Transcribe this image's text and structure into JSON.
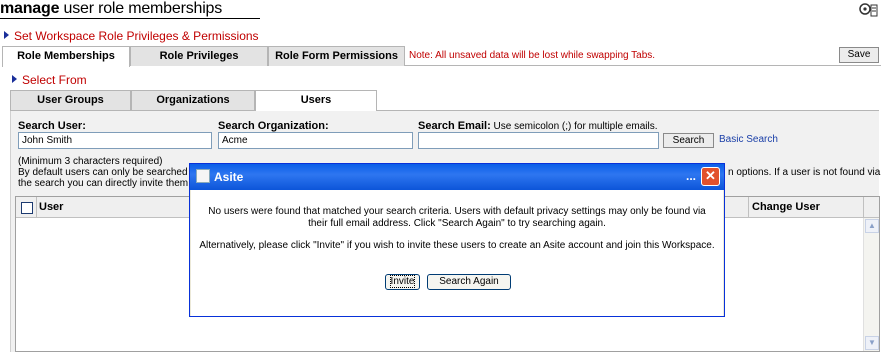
{
  "page": {
    "title_bold": "manage",
    "title_rest": " user role memberships"
  },
  "icons": {
    "corner": "role-settings-icon"
  },
  "section1": {
    "heading": "Set Workspace Role Privileges & Permissions"
  },
  "top_tabs": [
    {
      "label": "Role Memberships"
    },
    {
      "label": "Role Privileges"
    },
    {
      "label": "Role Form Permissions"
    }
  ],
  "tab_note": "Note: All unsaved data will be lost while swapping Tabs.",
  "save_label": "Save",
  "section2": {
    "heading": "Select From"
  },
  "sub_tabs": [
    {
      "label": "User Groups"
    },
    {
      "label": "Organizations"
    },
    {
      "label": "Users"
    }
  ],
  "search": {
    "user_label": "Search User:",
    "user_value": "John Smith",
    "org_label": "Search Organization:",
    "org_value": "Acme",
    "email_label": "Search Email:",
    "email_hint": " Use semicolon (;) for multiple emails.",
    "email_value": "",
    "search_button": "Search",
    "basic_search_link": "Basic Search"
  },
  "help": {
    "line1": "(Minimum 3 characters required)",
    "line2": "By default users can only be searched v",
    "line3": "the search you can directly invite them",
    "right_fragment": "n options. If a user is not found via"
  },
  "grid": {
    "col_user": "User",
    "col_change_user": "Change User"
  },
  "dialog": {
    "title": "Asite",
    "dots": "...",
    "message_line1": "No users were found that matched your search criteria. Users with default privacy settings may only be found via",
    "message_line2": "their full email address. Click \"Search Again\" to try searching again.",
    "message_line3": "Alternatively, please click \"Invite\" if you wish to invite these users to create an Asite account and join this Workspace.",
    "invite_button": "Invite",
    "search_again_button": "Search Again"
  }
}
